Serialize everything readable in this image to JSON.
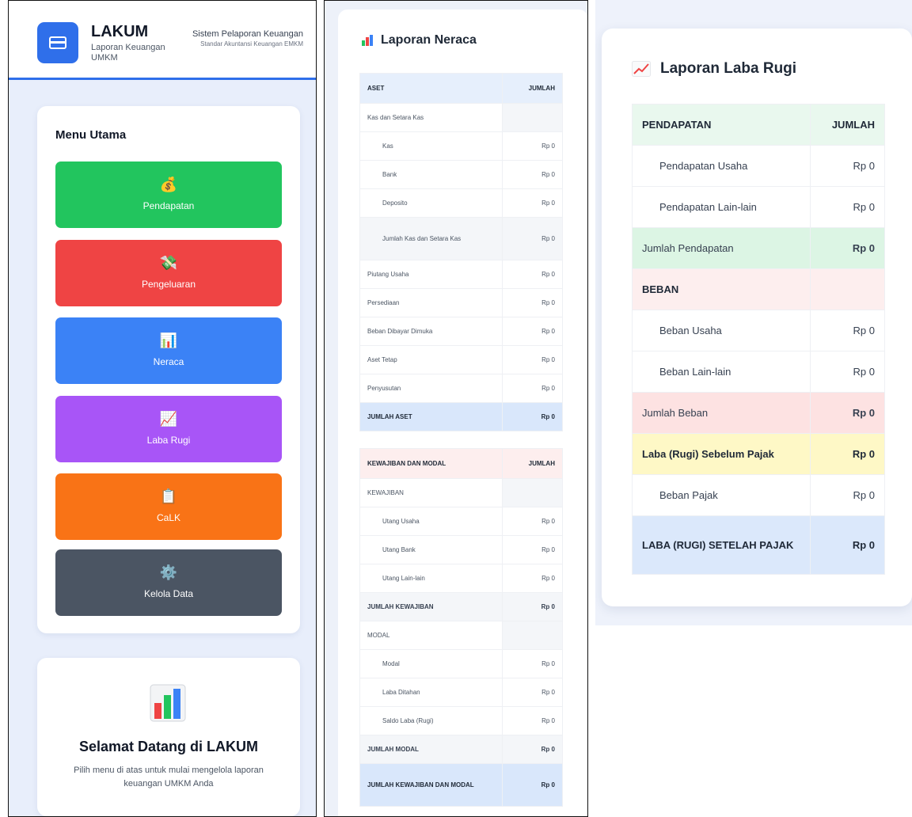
{
  "sidebar": {
    "brand_name": "LAKUM",
    "brand_subtitle": "Laporan Keuangan UMKM",
    "header_right_line1": "Sistem Pelaporan Keuangan",
    "header_right_line2": "Standar Akuntansi Keuangan EMKM",
    "menu_title": "Menu Utama",
    "menu_items": [
      {
        "label": "Pendapatan",
        "icon": "money-bag-icon",
        "color": "#22c55e"
      },
      {
        "label": "Pengeluaran",
        "icon": "money-wings-icon",
        "color": "#ef4444"
      },
      {
        "label": "Neraca",
        "icon": "bar-chart-icon",
        "color": "#3b82f6"
      },
      {
        "label": "Laba Rugi",
        "icon": "chart-increasing-icon",
        "color": "#a855f7"
      },
      {
        "label": "CaLK",
        "icon": "clipboard-icon",
        "color": "#f97316"
      },
      {
        "label": "Kelola Data",
        "icon": "gear-icon",
        "color": "#4b5563"
      }
    ],
    "welcome_title": "Selamat Datang di LAKUM",
    "welcome_desc": "Pilih menu di atas untuk mulai mengelola laporan keuangan UMKM Anda"
  },
  "neraca": {
    "title": "Laporan Neraca",
    "aset_header": "ASET",
    "jumlah_header": "JUMLAH",
    "kas_group": "Kas dan Setara Kas",
    "kas_items": [
      {
        "label": "Kas",
        "value": "Rp 0"
      },
      {
        "label": "Bank",
        "value": "Rp 0"
      },
      {
        "label": "Deposito",
        "value": "Rp 0"
      }
    ],
    "kas_total_label": "Jumlah Kas dan Setara Kas",
    "kas_total_value": "Rp 0",
    "aset_items": [
      {
        "label": "Piutang Usaha",
        "value": "Rp 0"
      },
      {
        "label": "Persediaan",
        "value": "Rp 0"
      },
      {
        "label": "Beban Dibayar Dimuka",
        "value": "Rp 0"
      },
      {
        "label": "Aset Tetap",
        "value": "Rp 0"
      },
      {
        "label": "Penyusutan",
        "value": "Rp 0"
      }
    ],
    "aset_total_label": "JUMLAH ASET",
    "aset_total_value": "Rp 0",
    "kwj_modal_header": "KEWAJIBAN DAN MODAL",
    "kewajiban_group": "KEWAJIBAN",
    "kewajiban_items": [
      {
        "label": "Utang Usaha",
        "value": "Rp 0"
      },
      {
        "label": "Utang Bank",
        "value": "Rp 0"
      },
      {
        "label": "Utang Lain-lain",
        "value": "Rp 0"
      }
    ],
    "kewajiban_total_label": "JUMLAH KEWAJIBAN",
    "kewajiban_total_value": "Rp 0",
    "modal_group": "MODAL",
    "modal_items": [
      {
        "label": "Modal",
        "value": "Rp 0"
      },
      {
        "label": "Laba Ditahan",
        "value": "Rp 0"
      },
      {
        "label": "Saldo Laba (Rugi)",
        "value": "Rp 0"
      }
    ],
    "modal_total_label": "JUMLAH MODAL",
    "modal_total_value": "Rp 0",
    "grand_total_label": "JUMLAH KEWAJIBAN DAN MODAL",
    "grand_total_value": "Rp 0"
  },
  "laba_rugi": {
    "title": "Laporan Laba Rugi",
    "pendapatan_header": "PENDAPATAN",
    "jumlah_header": "JUMLAH",
    "pendapatan_items": [
      {
        "label": "Pendapatan Usaha",
        "value": "Rp 0"
      },
      {
        "label": "Pendapatan Lain-lain",
        "value": "Rp 0"
      }
    ],
    "pendapatan_total_label": "Jumlah Pendapatan",
    "pendapatan_total_value": "Rp 0",
    "beban_header": "BEBAN",
    "beban_items": [
      {
        "label": "Beban Usaha",
        "value": "Rp 0"
      },
      {
        "label": "Beban Lain-lain",
        "value": "Rp 0"
      }
    ],
    "beban_total_label": "Jumlah Beban",
    "beban_total_value": "Rp 0",
    "sebelum_pajak_label": "Laba (Rugi) Sebelum Pajak",
    "sebelum_pajak_value": "Rp 0",
    "beban_pajak_label": "Beban Pajak",
    "beban_pajak_value": "Rp 0",
    "setelah_pajak_label": "LABA (RUGI) SETELAH PAJAK",
    "setelah_pajak_value": "Rp 0"
  }
}
